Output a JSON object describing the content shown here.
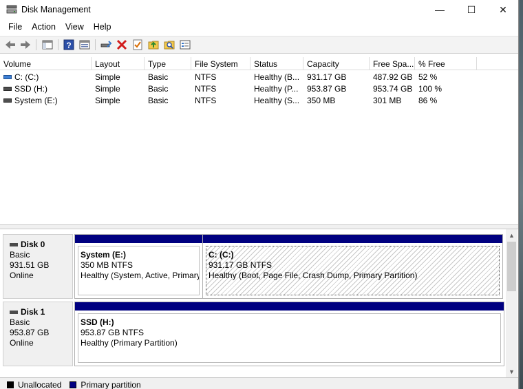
{
  "window": {
    "title": "Disk Management",
    "minimize_glyph": "—",
    "maximize_glyph": "☐",
    "close_glyph": "✕"
  },
  "menu": [
    "File",
    "Action",
    "View",
    "Help"
  ],
  "toolbar": {
    "icons": [
      "back-arrow-icon",
      "forward-arrow-icon",
      "console-tree-icon",
      "help-icon",
      "properties-icon",
      "connect-drive-icon",
      "delete-icon",
      "check-icon",
      "folder-up-icon",
      "search-folder-icon",
      "settings-list-icon"
    ]
  },
  "volume_list": {
    "columns": [
      "Volume",
      "Layout",
      "Type",
      "File System",
      "Status",
      "Capacity",
      "Free Spa...",
      "% Free"
    ],
    "rows": [
      {
        "volume": "C: (C:)",
        "layout": "Simple",
        "type": "Basic",
        "fs": "NTFS",
        "status": "Healthy (B...",
        "capacity": "931.17 GB",
        "free": "487.92 GB",
        "pct": "52 %",
        "icon": "blue"
      },
      {
        "volume": "SSD (H:)",
        "layout": "Simple",
        "type": "Basic",
        "fs": "NTFS",
        "status": "Healthy (P...",
        "capacity": "953.87 GB",
        "free": "953.74 GB",
        "pct": "100 %",
        "icon": "gray"
      },
      {
        "volume": "System (E:)",
        "layout": "Simple",
        "type": "Basic",
        "fs": "NTFS",
        "status": "Healthy (S...",
        "capacity": "350 MB",
        "free": "301 MB",
        "pct": "86 %",
        "icon": "gray"
      }
    ]
  },
  "disks": [
    {
      "name": "Disk 0",
      "type": "Basic",
      "size": "931.51 GB",
      "state": "Online",
      "partitions": [
        {
          "title": "System  (E:)",
          "size": "350 MB NTFS",
          "status": "Healthy (System, Active, Primary Partition)",
          "hatched": false
        },
        {
          "title": "C:  (C:)",
          "size": "931.17 GB NTFS",
          "status": "Healthy (Boot, Page File, Crash Dump, Primary Partition)",
          "hatched": true
        }
      ]
    },
    {
      "name": "Disk 1",
      "type": "Basic",
      "size": "953.87 GB",
      "state": "Online",
      "partitions": [
        {
          "title": "SSD  (H:)",
          "size": "953.87 GB NTFS",
          "status": "Healthy (Primary Partition)",
          "hatched": false
        }
      ]
    }
  ],
  "legend": [
    {
      "label": "Unallocated",
      "color": "#000000"
    },
    {
      "label": "Primary partition",
      "color": "#000080"
    }
  ],
  "colors": {
    "partition_bar": "#000080",
    "selection_blue": "#3d7fd4"
  }
}
